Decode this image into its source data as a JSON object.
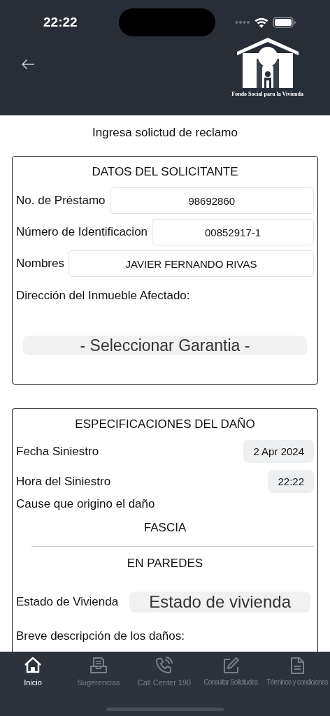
{
  "status_bar": {
    "time": "22:22"
  },
  "header": {
    "logo_caption": "Fondo Social para la Vivienda"
  },
  "page_title": "Ingresa solictud de reclamo",
  "applicant": {
    "title": "DATOS DEL SOLICITANTE",
    "fields": [
      {
        "label": "No. de Préstamo",
        "value": "98692860"
      },
      {
        "label": "Número de Identificacion",
        "value": "00852917-1"
      },
      {
        "label": "Nombres",
        "value": "JAVIER FERNANDO RIVAS"
      }
    ],
    "address_label": "Dirección del Inmueble Afectado:",
    "guarantee_picker": {
      "value": "- Seleccionar Garantia -"
    }
  },
  "damage": {
    "title": "ESPECIFICACIONES DEL DAÑO",
    "date": {
      "label": "Fecha Siniestro",
      "value": "2 Apr 2024"
    },
    "time": {
      "label": "Hora del Siniestro",
      "value": "22:22"
    },
    "cause_label": "Cause que origino el daño",
    "cause_items": [
      "FASCIA",
      "EN PAREDES"
    ],
    "housing_state": {
      "label": "Estado de Vivienda",
      "value": "Estado de vivienda"
    },
    "description_label": "Breve descripción de los daños:"
  },
  "tab_bar": [
    {
      "label": "Inicio",
      "kind": "home",
      "selected": true
    },
    {
      "label": "Sugerencias",
      "kind": "tray",
      "selected": false
    },
    {
      "label": "Call Center 190",
      "kind": "phone",
      "selected": false
    },
    {
      "label": "Consultar Solicitudes",
      "kind": "edit",
      "selected": false
    },
    {
      "label": "Términos y condiciones",
      "kind": "document",
      "selected": false
    }
  ]
}
